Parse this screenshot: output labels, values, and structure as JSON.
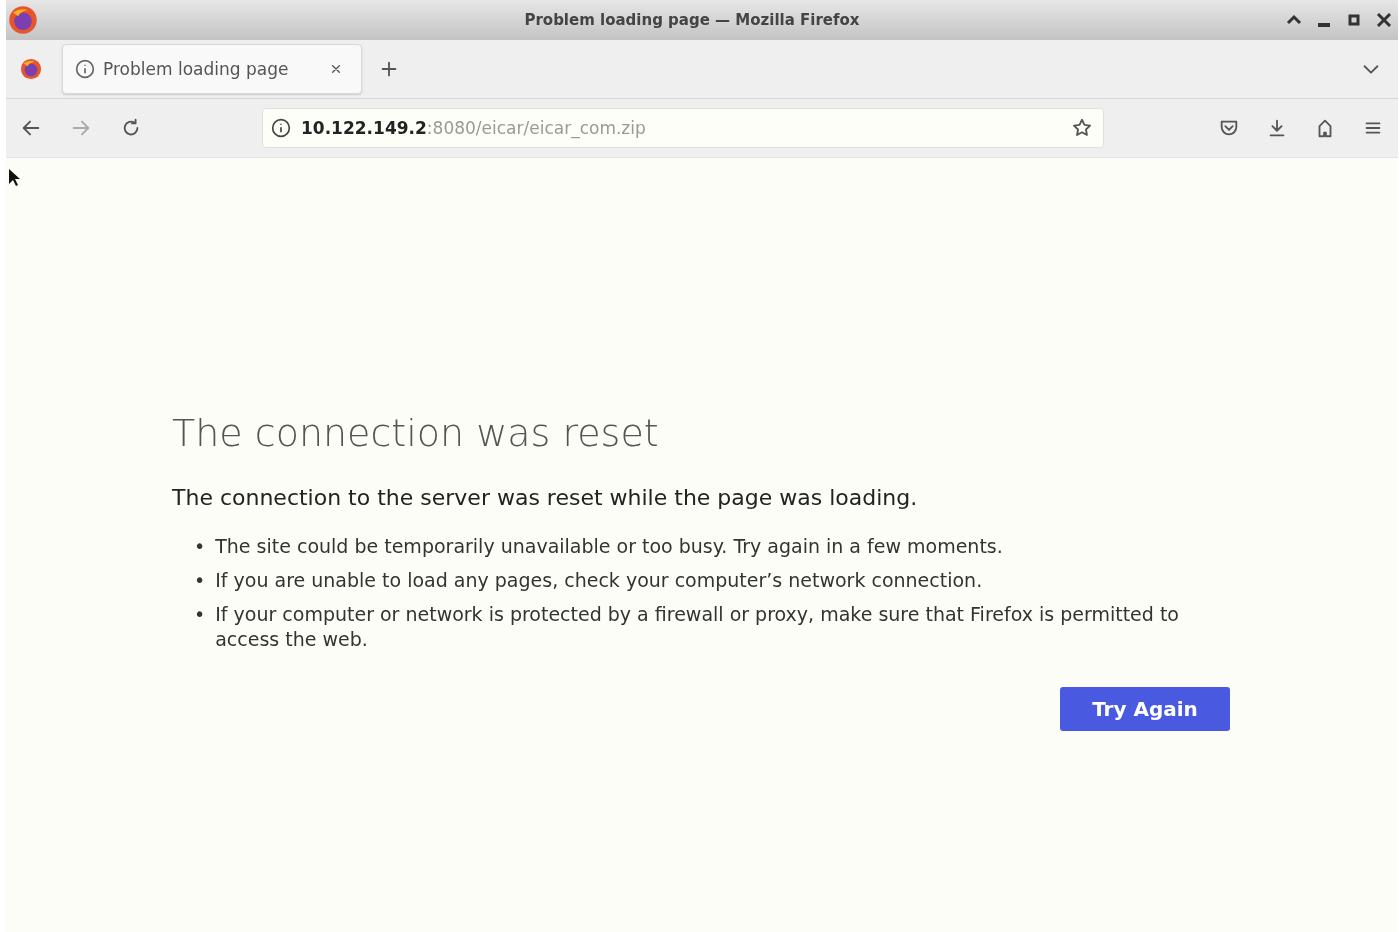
{
  "window": {
    "title": "Problem loading page — Mozilla Firefox"
  },
  "tabs": [
    {
      "label": "Problem loading page",
      "selected": true
    }
  ],
  "url": {
    "host": "10.122.149.2",
    "rest": ":8080/eicar/eicar_com.zip"
  },
  "error": {
    "title": "The connection was reset",
    "subtitle": "The connection to the server was reset while the page was loading.",
    "bullets": [
      {
        "marker": "•",
        "text": "The site could be temporarily unavailable or too busy. Try again in a few moments."
      },
      {
        "marker": "•",
        "text": "If you are unable to load any pages, check your computer’s network connection."
      },
      {
        "marker": "•",
        "text": "If your computer or network is protected by a firewall or proxy, make sure that Firefox is permitted to access the web."
      }
    ],
    "button": "Try Again"
  }
}
